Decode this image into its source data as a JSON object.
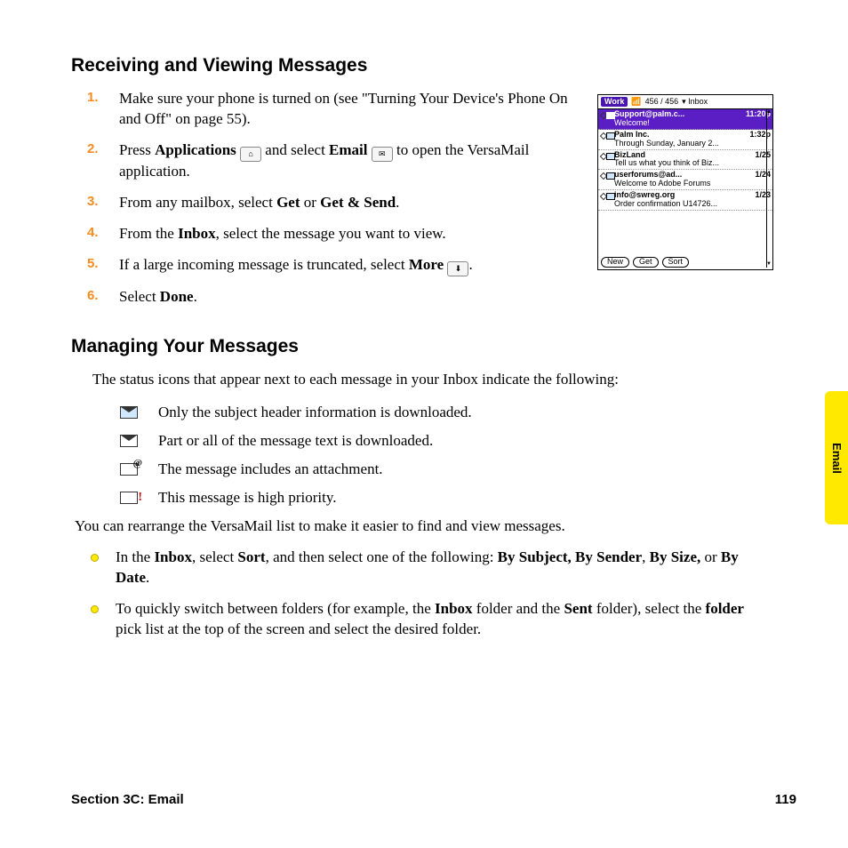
{
  "side_tab": "Email",
  "heading1": "Receiving and Viewing Messages",
  "steps1": {
    "s1": "Make sure your phone is turned on (see \"Turning Your Device's Phone On and Off\" on page 55).",
    "s2a": "Press ",
    "s2b": "Applications",
    "s2c": " and select ",
    "s2d": "Email",
    "s2e": " to open the VersaMail application.",
    "s3a": "From any mailbox, select ",
    "s3b": "Get",
    "s3c": " or ",
    "s3d": "Get & Send",
    "s3e": ".",
    "s4a": "From the ",
    "s4b": "Inbox",
    "s4c": ", select the message you want to view.",
    "s5a": "If a large incoming message is truncated, select ",
    "s5b": "More",
    "s5c": ".",
    "s6a": "Select ",
    "s6b": "Done",
    "s6c": "."
  },
  "heading2": "Managing Your Messages",
  "intro2": "The status icons that appear next to each message in your Inbox indicate the following:",
  "icons": {
    "closed": "Only the subject header information is downloaded.",
    "open": "Part or all of the message text is downloaded.",
    "attach": "The message includes an attachment.",
    "priority": "This message is high priority."
  },
  "para2": "You can rearrange the VersaMail list to make it easier to find and view messages.",
  "bullets": {
    "b1a": "In the ",
    "b1b": "Inbox",
    "b1c": ", select ",
    "b1d": "Sort",
    "b1e": ", and then select one of the following: ",
    "b1f": "By Subject, By Sender",
    "b1g": ", ",
    "b1h": "By Size,",
    "b1i": " or ",
    "b1j": "By Date",
    "b1k": ".",
    "b2a": "To quickly switch between folders (for example, the ",
    "b2b": "Inbox",
    "b2c": " folder and the ",
    "b2d": "Sent",
    "b2e": " folder), select the ",
    "b2f": "folder",
    "b2g": " pick list at the top of the screen and select the desired folder."
  },
  "footer": {
    "section": "Section 3C: Email",
    "page": "119"
  },
  "inline_icons": {
    "applications": "⌂",
    "email": "✉",
    "more": "⬇"
  },
  "screenshot": {
    "account_badge": "Work",
    "count": "456 / 456",
    "folder": "Inbox",
    "rows": [
      {
        "sender": "Support@palm.c...",
        "time": "11:20p",
        "preview": "Welcome!",
        "selected": true
      },
      {
        "sender": "Palm Inc.",
        "time": "1:32p",
        "preview": "Through Sunday, January 2...",
        "selected": false
      },
      {
        "sender": "BizLand",
        "time": "1/25",
        "preview": "Tell us what you think of Biz...",
        "selected": false
      },
      {
        "sender": "userforums@ad...",
        "time": "1/24",
        "preview": "Welcome to Adobe Forums",
        "selected": false
      },
      {
        "sender": "info@swreg.org",
        "time": "1/23",
        "preview": "Order confirmation U14726...",
        "selected": false
      }
    ],
    "buttons": {
      "new": "New",
      "get": "Get",
      "sort": "Sort"
    }
  }
}
